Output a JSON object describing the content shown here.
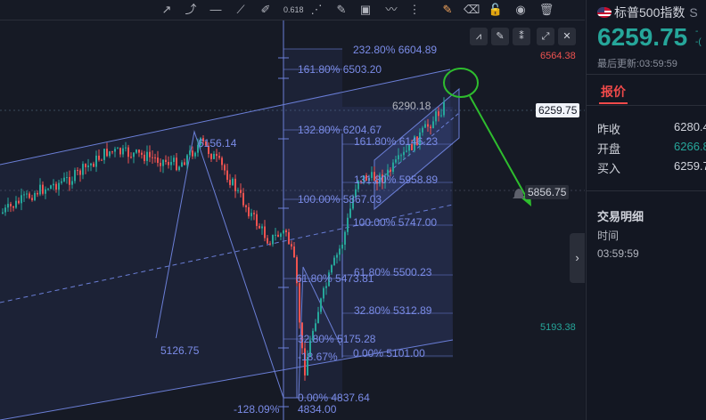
{
  "toolbar": {
    "icons": [
      "arrow-tool-icon",
      "ray-tool-icon",
      "horizontal-line-icon",
      "trend-line-icon",
      "brush-icon",
      "fib-retracement-icon",
      "fib-fan-icon",
      "highlighter-icon",
      "image-icon",
      "path-icon",
      "more-icon",
      "edit-icon",
      "eraser-icon",
      "lock-icon",
      "eye-icon",
      "trash-icon"
    ],
    "fib_badge": "0.618"
  },
  "chart": {
    "price_axis": {
      "top_label": "6564.38",
      "current_price": "6259.75",
      "cursor_price": "5856.75",
      "bottom_label": "5193.38"
    },
    "colors": {
      "up": "#26a69a",
      "down": "#ef5350",
      "drawing": "#6b7fd7",
      "annotation": "#2ebd2e",
      "current_tag": "#f0f3fa"
    },
    "fib_left": [
      {
        "label": "232.80% 6604.89"
      },
      {
        "label": "161.80% 6503.20"
      },
      {
        "label": "132.80% 6204.67"
      },
      {
        "label": "100.00% 5867.03"
      },
      {
        "label": "61.80% 5473.81"
      },
      {
        "label": "32.80% 5175.28"
      },
      {
        "label": "0.00% 4837.64"
      }
    ],
    "fib_right": [
      {
        "label": "161.80% 6146.23"
      },
      {
        "label": "131.80% 5958.89"
      },
      {
        "label": "100.00% 5747.00"
      },
      {
        "label": "61.80% 5500.23"
      },
      {
        "label": "32.80% 5312.89"
      },
      {
        "label": "0.00% 5101.00"
      }
    ],
    "point_labels": {
      "high": "6156.14",
      "low_left": "5126.75",
      "low_bottom": "4834.00",
      "neg_left": "-128.09%",
      "neg_mid": "-18.67%",
      "last_high": "6290.18"
    }
  },
  "panel": {
    "title": "标普500指数",
    "title_suffix": "S",
    "price": "6259.75",
    "change_partial": "-",
    "change_pct_partial": "-(",
    "updated_label": "最后更新:",
    "updated_time": "03:59:59",
    "tab_label": "报价",
    "rows": [
      {
        "label": "昨收",
        "value": "6280.4"
      },
      {
        "label": "开盘",
        "value": "6266.8"
      },
      {
        "label": "买入",
        "value": "6259.7"
      }
    ],
    "details_title": "交易明细",
    "time_label": "时间",
    "time_value": "03:59:59"
  }
}
